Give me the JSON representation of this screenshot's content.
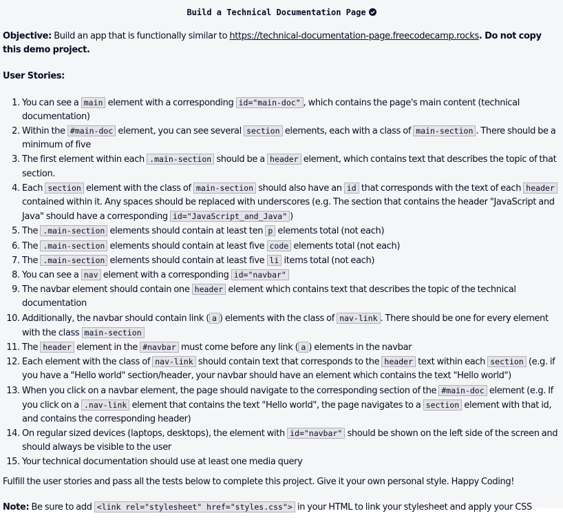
{
  "title": "Build a Technical Documentation Page",
  "objective": {
    "label": "Objective:",
    "pre": "Build an app that is functionally similar to",
    "link": "https://technical-documentation-page.freecodecamp.rocks",
    "post": "Do not copy this demo project."
  },
  "stories_heading": "User Stories:",
  "stories": [
    [
      {
        "t": "You can see a "
      },
      {
        "c": "main"
      },
      {
        "t": " element with a corresponding "
      },
      {
        "c": "id=\"main-doc\""
      },
      {
        "t": ", which contains the page's main content (technical documentation)"
      }
    ],
    [
      {
        "t": "Within the "
      },
      {
        "c": "#main-doc"
      },
      {
        "t": " element, you can see several "
      },
      {
        "c": "section"
      },
      {
        "t": " elements, each with a class of "
      },
      {
        "c": "main-section"
      },
      {
        "t": ". There should be a minimum of five"
      }
    ],
    [
      {
        "t": "The first element within each "
      },
      {
        "c": ".main-section"
      },
      {
        "t": " should be a "
      },
      {
        "c": "header"
      },
      {
        "t": " element, which contains text that describes the topic of that section."
      }
    ],
    [
      {
        "t": "Each "
      },
      {
        "c": "section"
      },
      {
        "t": " element with the class of "
      },
      {
        "c": "main-section"
      },
      {
        "t": " should also have an "
      },
      {
        "c": "id"
      },
      {
        "t": " that corresponds with the text of each "
      },
      {
        "c": "header"
      },
      {
        "t": " contained within it. Any spaces should be replaced with underscores (e.g. The section that contains the header \"JavaScript and Java\" should have a corresponding "
      },
      {
        "c": "id=\"JavaScript_and_Java\""
      },
      {
        "t": ")"
      }
    ],
    [
      {
        "t": "The "
      },
      {
        "c": ".main-section"
      },
      {
        "t": " elements should contain at least ten "
      },
      {
        "c": "p"
      },
      {
        "t": " elements total (not each)"
      }
    ],
    [
      {
        "t": "The "
      },
      {
        "c": ".main-section"
      },
      {
        "t": " elements should contain at least five "
      },
      {
        "c": "code"
      },
      {
        "t": " elements total (not each)"
      }
    ],
    [
      {
        "t": "The "
      },
      {
        "c": ".main-section"
      },
      {
        "t": " elements should contain at least five "
      },
      {
        "c": "li"
      },
      {
        "t": " items total (not each)"
      }
    ],
    [
      {
        "t": "You can see a "
      },
      {
        "c": "nav"
      },
      {
        "t": " element with a corresponding "
      },
      {
        "c": "id=\"navbar\""
      }
    ],
    [
      {
        "t": "The navbar element should contain one "
      },
      {
        "c": "header"
      },
      {
        "t": " element which contains text that describes the topic of the technical documentation"
      }
    ],
    [
      {
        "t": "Additionally, the navbar should contain link ("
      },
      {
        "c": "a"
      },
      {
        "t": ") elements with the class of "
      },
      {
        "c": "nav-link"
      },
      {
        "t": ". There should be one for every element with the class "
      },
      {
        "c": "main-section"
      }
    ],
    [
      {
        "t": "The "
      },
      {
        "c": "header"
      },
      {
        "t": " element in the "
      },
      {
        "c": "#navbar"
      },
      {
        "t": " must come before any link ("
      },
      {
        "c": "a"
      },
      {
        "t": ") elements in the navbar"
      }
    ],
    [
      {
        "t": "Each element with the class of "
      },
      {
        "c": "nav-link"
      },
      {
        "t": " should contain text that corresponds to the "
      },
      {
        "c": "header"
      },
      {
        "t": " text within each "
      },
      {
        "c": "section"
      },
      {
        "t": " (e.g. if you have a \"Hello world\" section/header, your navbar should have an element which contains the text \"Hello world\")"
      }
    ],
    [
      {
        "t": "When you click on a navbar element, the page should navigate to the corresponding section of the "
      },
      {
        "c": "#main-doc"
      },
      {
        "t": " element (e.g. If you click on a "
      },
      {
        "c": ".nav-link"
      },
      {
        "t": " element that contains the text \"Hello world\", the page navigates to a "
      },
      {
        "c": "section"
      },
      {
        "t": " element with that id, and contains the corresponding header)"
      }
    ],
    [
      {
        "t": "On regular sized devices (laptops, desktops), the element with "
      },
      {
        "c": "id=\"navbar\""
      },
      {
        "t": " should be shown on the left side of the screen and should always be visible to the user"
      }
    ],
    [
      {
        "t": "Your technical documentation should use at least one media query"
      }
    ]
  ],
  "fulfill": "Fulfill the user stories and pass all the tests below to complete this project. Give it your own personal style. Happy Coding!",
  "note": {
    "label": "Note:",
    "pre": "Be sure to add",
    "code": "<link rel=\"stylesheet\" href=\"styles.css\">",
    "post": "in your HTML to link your stylesheet and apply your CSS"
  },
  "icons": {
    "check": "check-circle-icon"
  }
}
